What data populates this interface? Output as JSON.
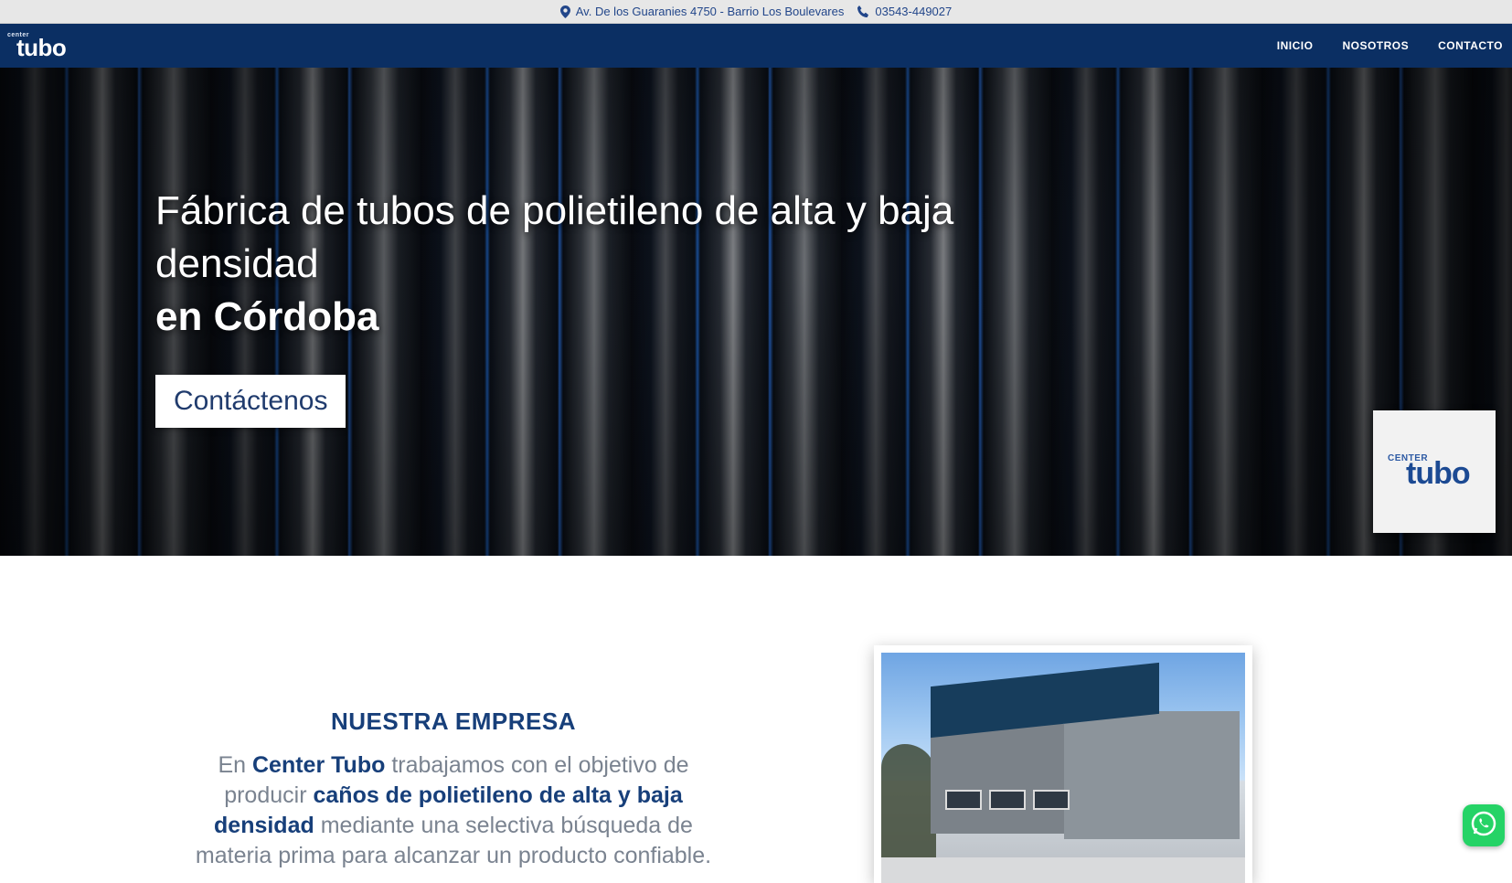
{
  "topbar": {
    "address": "Av. De los Guaranies 4750 - Barrio Los Boulevares",
    "phone": "03543-449027"
  },
  "nav": {
    "logo_small": "center",
    "logo_big": "tubo",
    "items": [
      "INICIO",
      "NOSOTROS",
      "CONTACTO"
    ]
  },
  "hero": {
    "title_line1": "Fábrica de tubos de polietileno de alta y baja densidad",
    "title_line2": "en Córdoba",
    "cta_label": "Contáctenos",
    "badge_small": "CENTER",
    "badge_big": "tubo"
  },
  "about": {
    "heading": "NUESTRA EMPRESA",
    "text_1": "En",
    "brand": "Center Tubo",
    "text_2": "trabajamos con el objetivo de producir",
    "bold_2": "caños de polietileno de alta y baja densidad",
    "text_3": "mediante una selectiva búsqueda de materia prima para alcanzar un producto confiable."
  },
  "colors": {
    "navy": "#0b2f63",
    "accent_text": "#173f7a",
    "whatsapp": "#25d366"
  }
}
